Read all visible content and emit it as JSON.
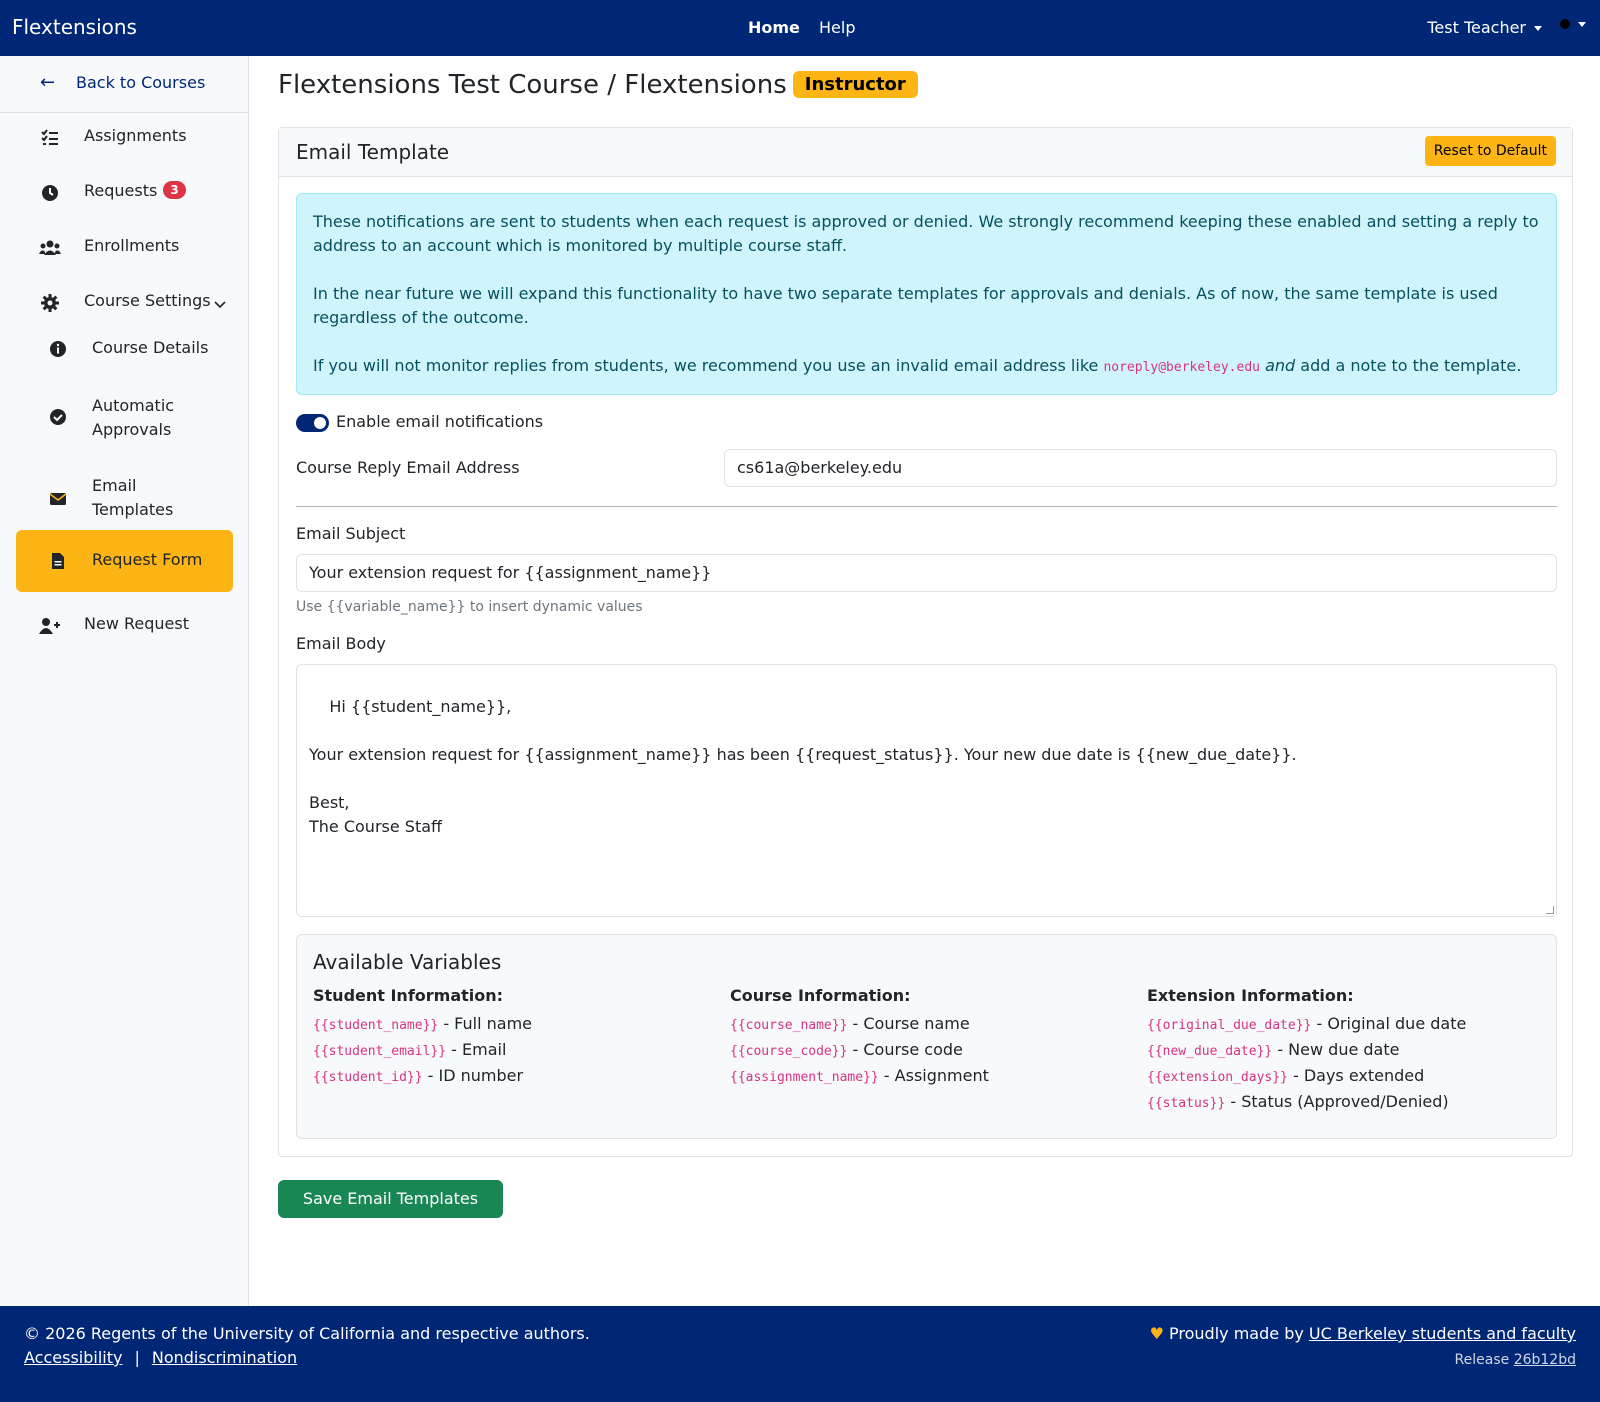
{
  "topnav": {
    "brand": "Flextensions",
    "links": [
      "Home",
      "Help"
    ],
    "user": "Test Teacher"
  },
  "sidebar": {
    "back_label": "Back to Courses",
    "items": [
      {
        "label": "Assignments",
        "icon": "list-check-icon"
      },
      {
        "label": "Requests",
        "icon": "clock-icon",
        "badge": "3"
      },
      {
        "label": "Enrollments",
        "icon": "users-icon"
      },
      {
        "label": "Course Settings",
        "icon": "gear-icon"
      },
      {
        "label": "Course Details",
        "icon": "info-circle-icon"
      },
      {
        "label": "Automatic Approvals",
        "icon": "check-circle-icon"
      },
      {
        "label": "Email Templates",
        "icon": "envelope-icon",
        "active": true
      },
      {
        "label": "Request Form",
        "icon": "file-icon"
      },
      {
        "label": "New Request",
        "icon": "user-plus-icon"
      }
    ]
  },
  "page": {
    "title": "Flextensions Test Course / Flextensions",
    "role": "Instructor"
  },
  "card": {
    "header": "Email Template",
    "reset_label": "Reset to Default",
    "alert": {
      "p1": "These notifications are sent to students when each request is approved or denied. We strongly recommend keeping these enabled and setting a reply to address to an account which is monitored by multiple course staff.",
      "p2": "In the near future we will expand this functionality to have two separate templates for approvals and denials. As of now, the same template is used regardless of the outcome.",
      "p3_pre": "If you will not monitor replies from students, we recommend you use an invalid email address like ",
      "p3_code": "noreply@berkeley.edu",
      "p3_em": "and",
      "p3_post": " add a note to the template."
    },
    "toggle_label": "Enable email notifications",
    "reply_label": "Course Reply Email Address",
    "reply_value": "cs61a@berkeley.edu",
    "subject_label": "Email Subject",
    "subject_value": "Your extension request for {{assignment_name}}",
    "subject_help": "Use {{variable_name}} to insert dynamic values",
    "body_label": "Email Body",
    "body_value": "Hi {{student_name}},\n\nYour extension request for {{assignment_name}} has been {{request_status}}. Your new due date is {{new_due_date}}.\n\nBest,\nThe Course Staff",
    "vars": {
      "title": "Available Variables",
      "student": {
        "heading": "Student Information:",
        "rows": [
          {
            "code": "{{student_name}}",
            "desc": " - Full name"
          },
          {
            "code": "{{student_email}}",
            "desc": " - Email"
          },
          {
            "code": "{{student_id}}",
            "desc": " - ID number"
          }
        ]
      },
      "course": {
        "heading": "Course Information:",
        "rows": [
          {
            "code": "{{course_name}}",
            "desc": " - Course name"
          },
          {
            "code": "{{course_code}}",
            "desc": " - Course code"
          },
          {
            "code": "{{assignment_name}}",
            "desc": " - Assignment"
          }
        ]
      },
      "extension": {
        "heading": "Extension Information:",
        "rows": [
          {
            "code": "{{original_due_date}}",
            "desc": " - Original due date"
          },
          {
            "code": "{{new_due_date}}",
            "desc": " - New due date"
          },
          {
            "code": "{{extension_days}}",
            "desc": " - Days extended"
          },
          {
            "code": "{{status}}",
            "desc": " - Status (Approved/Denied)"
          }
        ]
      }
    }
  },
  "save_label": "Save Email Templates",
  "footer": {
    "copyright": "© 2026 Regents of the University of California and respective authors.",
    "accessibility": "Accessibility",
    "separator": "|",
    "nondiscrimination": "Nondiscrimination",
    "made_by": "Proudly made by",
    "made_by_link": "UC Berkeley students and faculty",
    "release_label": "Release",
    "release_link": "26b12bd"
  },
  "colors": {
    "navy": "#002676",
    "gold": "#fdb515",
    "success": "#198754",
    "alert_bg": "#cff4fc",
    "code": "#d63384"
  }
}
